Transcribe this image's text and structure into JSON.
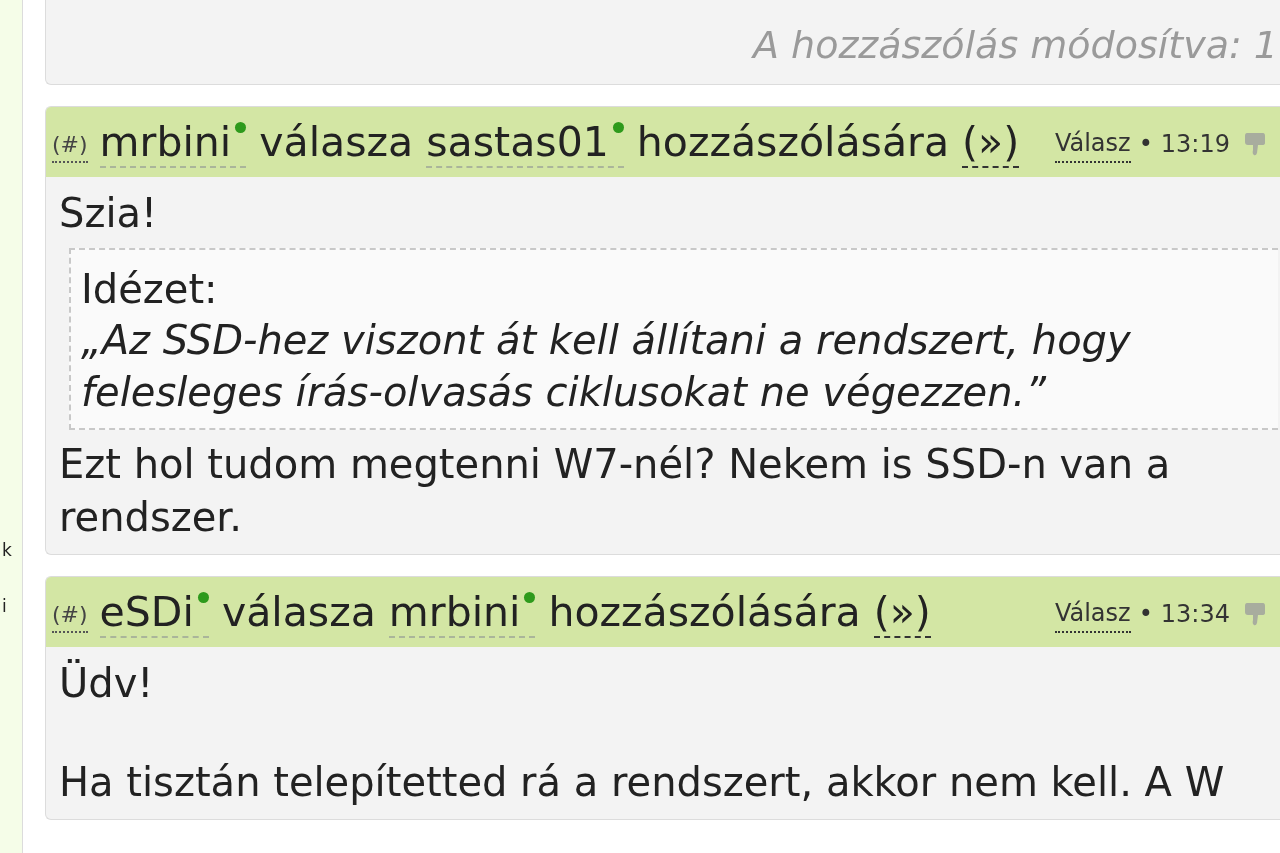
{
  "sidebar": {
    "letters": [
      "k",
      "i"
    ]
  },
  "previous_post": {
    "edited_note": "A hozzászólás módosítva: 1"
  },
  "posts": [
    {
      "permalink": "(#)",
      "author": "mrbini",
      "author_online": true,
      "verb": "válasza",
      "reply_to": "sastas01",
      "reply_to_online": true,
      "suffix": "hozzászólására",
      "parent_link": "(»)",
      "reply_link": "Válasz",
      "separator": "•",
      "time": "13:19",
      "body": [
        {
          "kind": "text",
          "text": "Szia!"
        },
        {
          "kind": "quote",
          "label": "Idézet:",
          "text": "„Az SSD-hez viszont át kell állítani a rendszert, hogy felesleges írás-olvasás ciklusokat ne végezzen.”"
        },
        {
          "kind": "text",
          "text": "Ezt hol tudom megtenni W7-nél? Nekem is SSD-n van a rendszer."
        }
      ]
    },
    {
      "permalink": "(#)",
      "author": "eSDi",
      "author_online": true,
      "verb": "válasza",
      "reply_to": "mrbini",
      "reply_to_online": true,
      "suffix": "hozzászólására",
      "parent_link": "(»)",
      "reply_link": "Válasz",
      "separator": "•",
      "time": "13:34",
      "body": [
        {
          "kind": "text",
          "text": "Üdv!"
        },
        {
          "kind": "text",
          "text": "Ha tisztán telepítetted rá a rendszert, akkor nem kell. A W"
        }
      ]
    }
  ]
}
